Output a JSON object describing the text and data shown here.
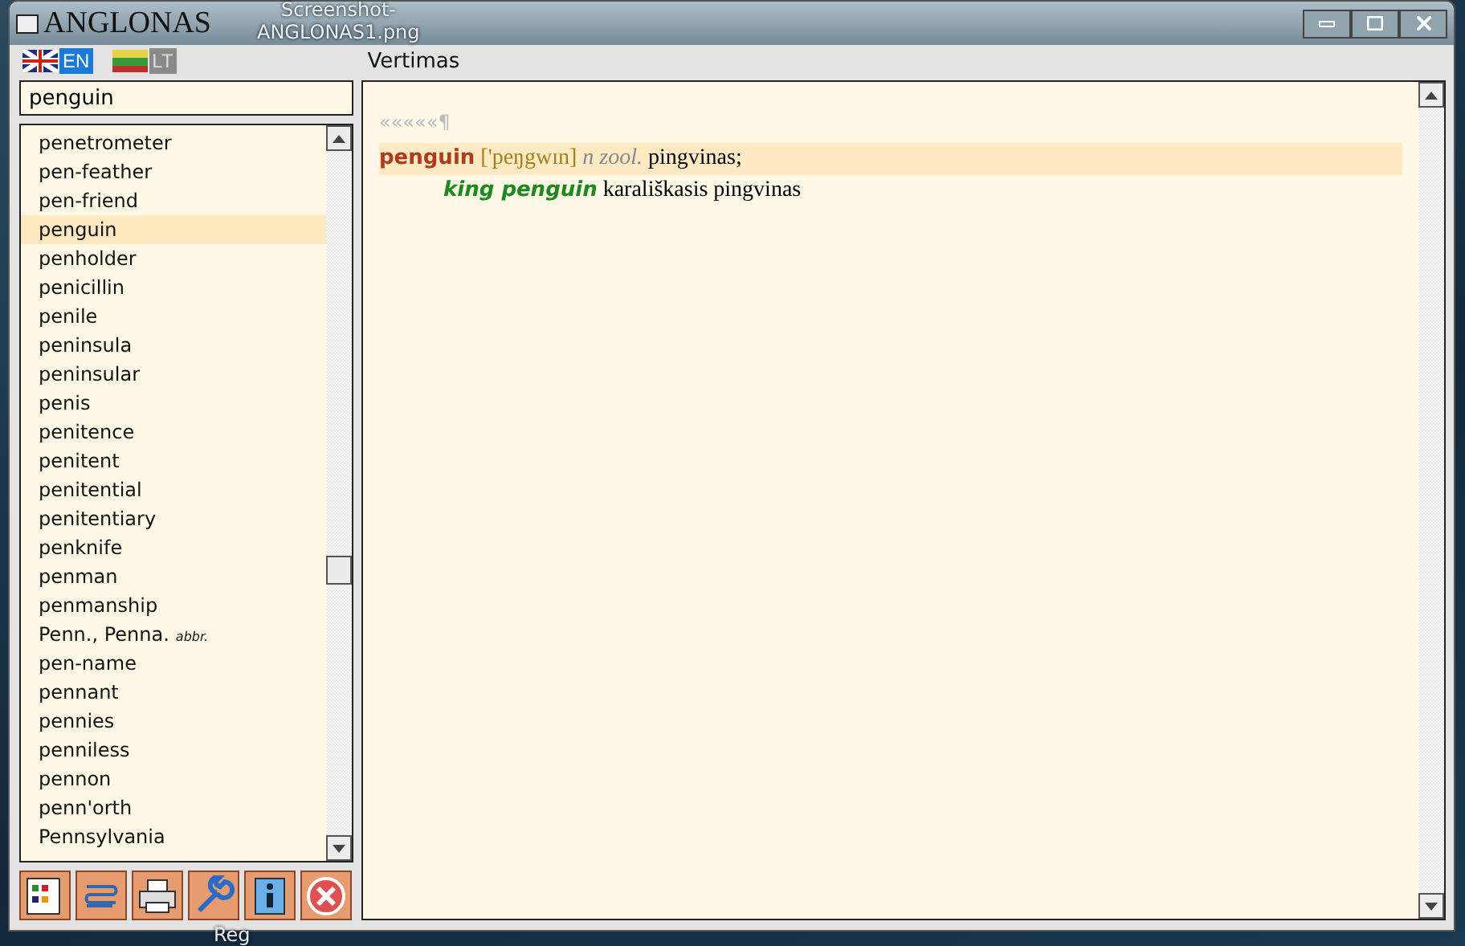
{
  "desktop": {
    "labels": [
      "Screenshot-",
      "ANGLONAS1.png",
      "Reg"
    ]
  },
  "window": {
    "title": "ANGLONAS"
  },
  "languages": [
    {
      "code": "EN",
      "selected": true
    },
    {
      "code": "LT",
      "selected": false
    }
  ],
  "pane_title": "Vertimas",
  "search": {
    "value": "penguin"
  },
  "words": [
    {
      "text": "penetrometer",
      "selected": false
    },
    {
      "text": "pen-feather",
      "selected": false
    },
    {
      "text": "pen-friend",
      "selected": false
    },
    {
      "text": "penguin",
      "selected": true
    },
    {
      "text": "penholder",
      "selected": false
    },
    {
      "text": "penicillin",
      "selected": false
    },
    {
      "text": "penile",
      "selected": false
    },
    {
      "text": "peninsula",
      "selected": false
    },
    {
      "text": "peninsular",
      "selected": false
    },
    {
      "text": "penis",
      "selected": false
    },
    {
      "text": "penitence",
      "selected": false
    },
    {
      "text": "penitent",
      "selected": false
    },
    {
      "text": "penitential",
      "selected": false
    },
    {
      "text": "penitentiary",
      "selected": false
    },
    {
      "text": "penknife",
      "selected": false
    },
    {
      "text": "penman",
      "selected": false
    },
    {
      "text": "penmanship",
      "selected": false
    },
    {
      "text": "Penn., Penna.",
      "note": "abbr.",
      "selected": false
    },
    {
      "text": "pen-name",
      "selected": false
    },
    {
      "text": "pennant",
      "selected": false
    },
    {
      "text": "pennies",
      "selected": false
    },
    {
      "text": "penniless",
      "selected": false
    },
    {
      "text": "pennon",
      "selected": false
    },
    {
      "text": "penn'orth",
      "selected": false
    },
    {
      "text": "Pennsylvania",
      "selected": false
    }
  ],
  "toolbar": [
    {
      "kind": "cards"
    },
    {
      "kind": "scroll"
    },
    {
      "kind": "print"
    },
    {
      "kind": "settings"
    },
    {
      "kind": "info"
    },
    {
      "kind": "close"
    }
  ],
  "translation": {
    "history": "«««««¶",
    "entry": {
      "headword": "penguin",
      "transcription": "['peŋgwɪn]",
      "grammar": "n zool.",
      "meaning": "pingvinas;"
    },
    "phrases": [
      {
        "phrase": "king penguin",
        "meaning": "karališkasis pingvinas"
      }
    ]
  }
}
